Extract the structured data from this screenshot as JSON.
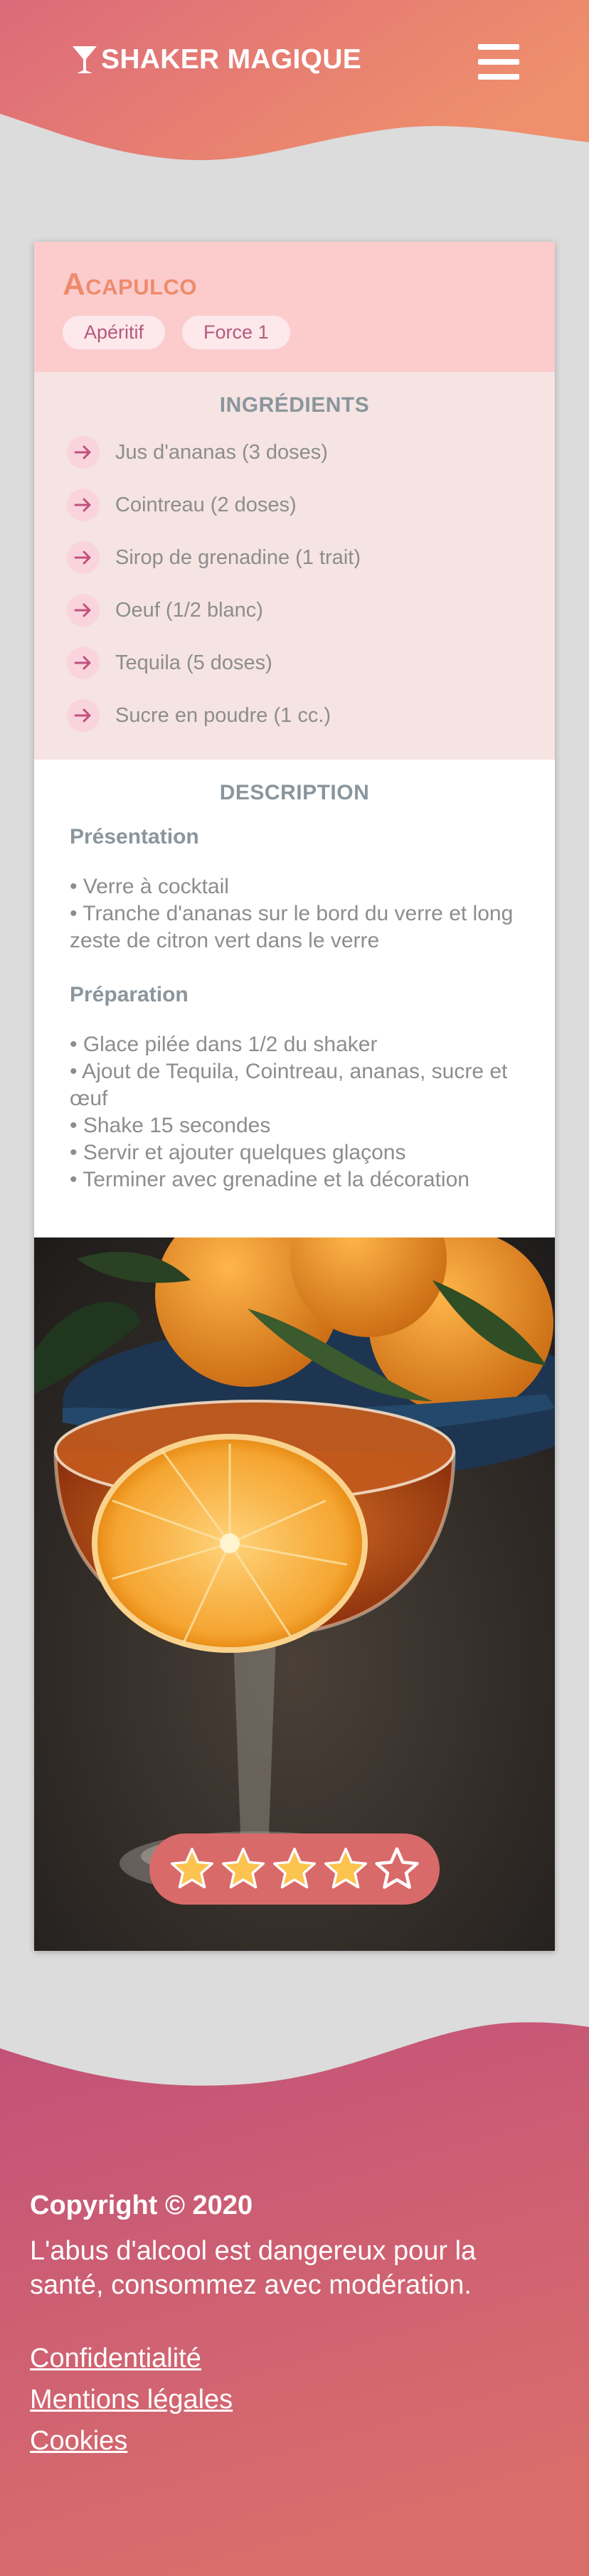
{
  "header": {
    "brand": "SHAKER MAGIQUE",
    "logo_icon": "cocktail-glass-icon",
    "menu_icon": "hamburger-menu-icon"
  },
  "cocktail": {
    "name": "Acapulco",
    "tags": [
      "Apéritif",
      "Force 1"
    ],
    "ingredients_title": "INGRÉDIENTS",
    "ingredients": [
      "Jus d'ananas (3 doses)",
      "Cointreau (2 doses)",
      "Sirop de grenadine (1 trait)",
      "Oeuf (1/2 blanc)",
      "Tequila (5 doses)",
      "Sucre en poudre (1 cc.)"
    ],
    "description_title": "DESCRIPTION",
    "presentation_title": "Présentation",
    "presentation": [
      "• Verre à cocktail",
      "• Tranche d'ananas sur le bord du verre et long zeste de citron vert dans le verre"
    ],
    "preparation_title": "Préparation",
    "preparation": [
      "• Glace pilée dans 1/2 du shaker",
      "• Ajout de Tequila, Cointreau, ananas, sucre et œuf",
      "• Shake 15 secondes",
      "• Servir et ajouter quelques glaçons",
      "• Terminer avec grenadine et la décoration"
    ],
    "rating": 4,
    "rating_max": 5
  },
  "footer": {
    "copyright": "Copyright © 2020",
    "warning": "L'abus d'alcool est dangereux pour la santé, consommez avec modération.",
    "links": [
      "Confidentialité",
      "Mentions légales",
      "Cookies"
    ]
  },
  "colors": {
    "header_gradient": [
      "#dd6b78",
      "#ee8d6e"
    ],
    "card_head_bg": "#fccccd",
    "title": "#ee8b6d",
    "ingredients_bg": "#f5e4e2",
    "arrow": "#c2517e",
    "rating_bg": "#d96a6a",
    "star_fill": "#fcc34f",
    "footer_gradient": [
      "#c25179",
      "#d96a6a"
    ]
  }
}
